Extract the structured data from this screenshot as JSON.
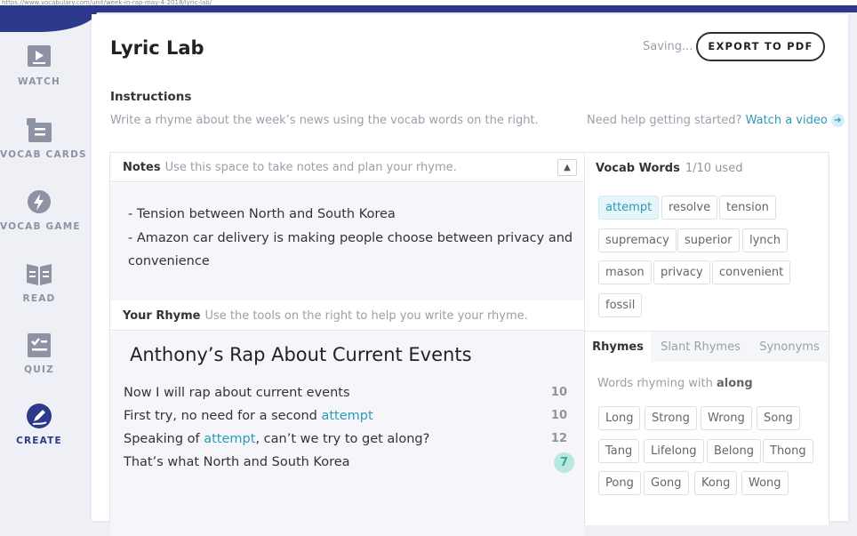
{
  "browser": {
    "url": "https://www.vocabulary.com/unit/week-in-rap-may-4-2018/lyric-lab/"
  },
  "sidebar": {
    "items": [
      {
        "label": "WATCH",
        "icon": "play-icon"
      },
      {
        "label": "VOCAB CARDS",
        "icon": "cards-icon"
      },
      {
        "label": "VOCAB GAME",
        "icon": "lightning-icon"
      },
      {
        "label": "READ",
        "icon": "book-icon"
      },
      {
        "label": "QUIZ",
        "icon": "checklist-icon"
      },
      {
        "label": "CREATE",
        "icon": "pencil-icon",
        "active": true
      }
    ]
  },
  "header": {
    "title": "Lyric Lab",
    "saving": "Saving...",
    "export_label": "EXPORT TO PDF"
  },
  "instructions": {
    "heading": "Instructions",
    "text": "Write a rhyme about the week’s news using the vocab words on the right.",
    "help_text": "Need help getting started?",
    "help_link": "Watch a video"
  },
  "notes": {
    "label": "Notes",
    "hint": "Use this space to take notes and plan your rhyme.",
    "lines": [
      "- Tension between North and South Korea",
      "- Amazon car delivery is making people choose between privacy and",
      "convenience"
    ]
  },
  "rhyme": {
    "label": "Your Rhyme",
    "hint": "Use the tools on the right to help you write your rhyme.",
    "title": "Anthony’s Rap About Current Events",
    "lines": [
      {
        "before": "Now I will rap about current events",
        "word": "",
        "after": "",
        "count": "10"
      },
      {
        "before": "First try, no need for a second ",
        "word": "attempt",
        "after": "",
        "count": "10"
      },
      {
        "before": "Speaking of ",
        "word": "attempt",
        "after": ", can’t we try to get along?",
        "count": "12"
      },
      {
        "before": "That’s what North and South Korea",
        "word": "",
        "after": "",
        "count": "7"
      }
    ]
  },
  "vocab": {
    "label": "Vocab Words",
    "used": "1/10 used",
    "words": [
      "attempt",
      "resolve",
      "tension",
      "supremacy",
      "superior",
      "lynch",
      "mason",
      "privacy",
      "convenient",
      "fossil"
    ]
  },
  "rhyme_tabs": [
    "Rhymes",
    "Slant Rhymes",
    "Synonyms"
  ],
  "rhymes": {
    "prefix": "Words rhyming with",
    "word": "along",
    "words": [
      "Long",
      "Strong",
      "Wrong",
      "Song",
      "Tang",
      "Lifelong",
      "Belong",
      "Thong",
      "Pong",
      "Gong",
      "Kong",
      "Wong"
    ]
  },
  "colors": {
    "accent": "#2a9bb8",
    "brand": "#2d3a8c",
    "badge": "#b9e8df"
  }
}
